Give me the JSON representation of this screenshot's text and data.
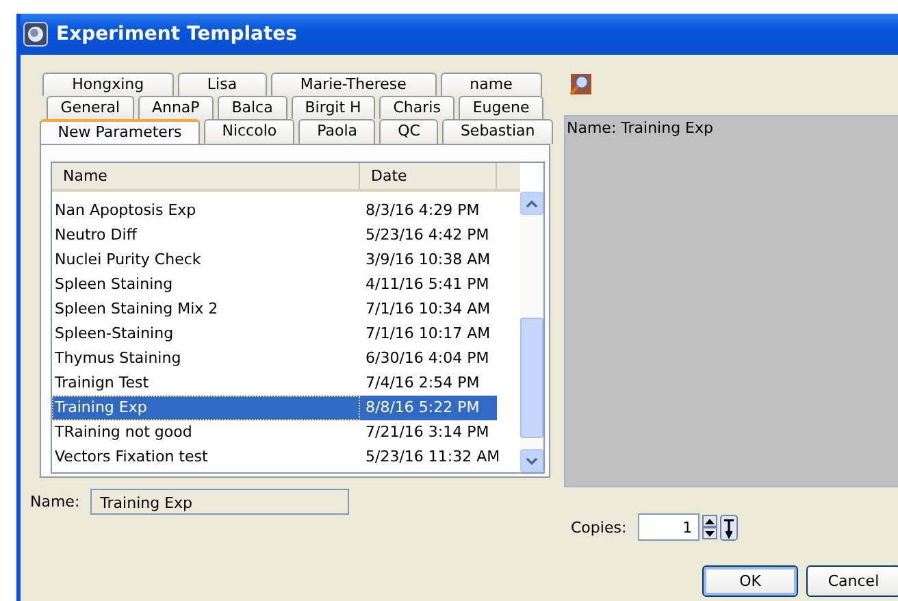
{
  "window": {
    "title": "Experiment Templates"
  },
  "tab_rows": [
    [
      {
        "label": "Hongxing",
        "selected": false
      },
      {
        "label": "Lisa",
        "selected": false
      },
      {
        "label": "Marie-Therese",
        "selected": false
      },
      {
        "label": "name",
        "selected": false
      }
    ],
    [
      {
        "label": "General",
        "selected": false
      },
      {
        "label": "AnnaP",
        "selected": false
      },
      {
        "label": "Balca",
        "selected": false
      },
      {
        "label": "Birgit H",
        "selected": false
      },
      {
        "label": "Charis",
        "selected": false
      },
      {
        "label": "Eugene",
        "selected": false
      }
    ],
    [
      {
        "label": "New Parameters",
        "selected": true
      },
      {
        "label": "Niccolo",
        "selected": false
      },
      {
        "label": "Paola",
        "selected": false
      },
      {
        "label": "QC",
        "selected": false
      },
      {
        "label": "Sebastian",
        "selected": false
      }
    ]
  ],
  "table": {
    "columns": [
      "Name",
      "Date"
    ],
    "rows": [
      {
        "name": "Nan Apoptosis Exp",
        "date": "8/3/16 4:29 PM",
        "selected": false
      },
      {
        "name": "Neutro Diff",
        "date": "5/23/16 4:42 PM",
        "selected": false
      },
      {
        "name": "Nuclei Purity Check",
        "date": "3/9/16 10:38 AM",
        "selected": false
      },
      {
        "name": "Spleen Staining",
        "date": "4/11/16 5:41 PM",
        "selected": false
      },
      {
        "name": "Spleen Staining Mix 2",
        "date": "7/1/16 10:34 AM",
        "selected": false
      },
      {
        "name": "Spleen-Staining",
        "date": "7/1/16 10:17 AM",
        "selected": false
      },
      {
        "name": "Thymus Staining",
        "date": "6/30/16 4:04 PM",
        "selected": false
      },
      {
        "name": "Trainign Test",
        "date": "7/4/16 2:54 PM",
        "selected": false
      },
      {
        "name": "Training Exp",
        "date": "8/8/16 5:22 PM",
        "selected": true
      },
      {
        "name": "TRaining not good",
        "date": "7/21/16 3:14 PM",
        "selected": false
      },
      {
        "name": "Vectors Fixation test",
        "date": "5/23/16 11:32 AM",
        "selected": false
      }
    ]
  },
  "preview": {
    "text": "Name: Training Exp"
  },
  "name_field": {
    "label": "Name:",
    "value": "Training Exp"
  },
  "copies": {
    "label": "Copies:",
    "value": "1"
  },
  "buttons": [
    {
      "label": "OK",
      "default": true
    },
    {
      "label": "Cancel",
      "default": false
    }
  ]
}
